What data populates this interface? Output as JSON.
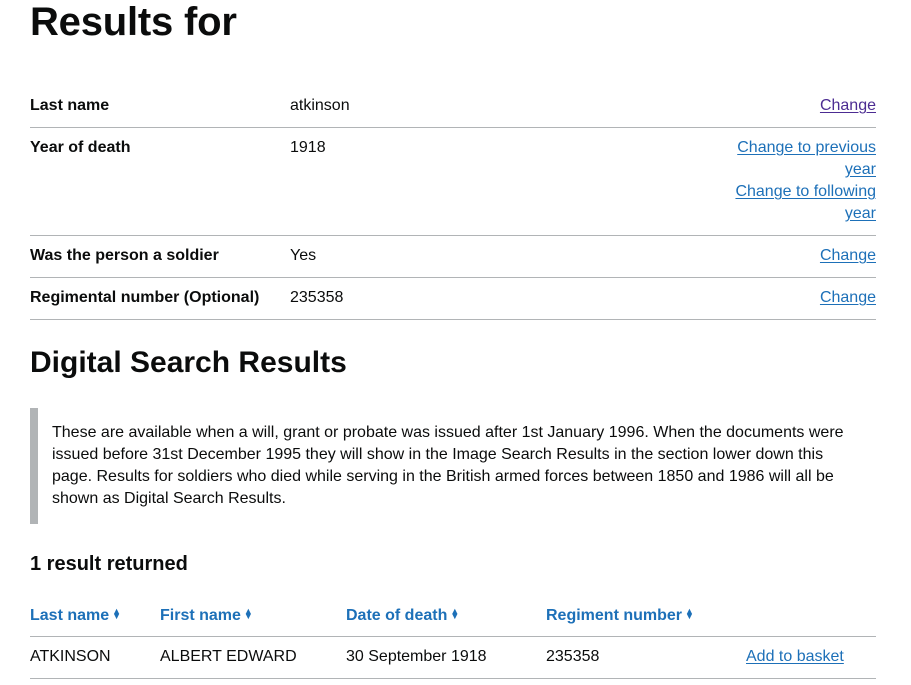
{
  "header": {
    "title": "Results for"
  },
  "summary": [
    {
      "key": "Last name",
      "value": "atkinson",
      "action": "Change"
    },
    {
      "key": "Year of death",
      "value": "1918",
      "action_prev": "Change to previous year",
      "action_next": "Change to following year"
    },
    {
      "key": "Was the person a soldier",
      "value": "Yes",
      "action": "Change"
    },
    {
      "key": "Regimental number (Optional)",
      "value": "235358",
      "action": "Change"
    }
  ],
  "digital": {
    "heading": "Digital Search Results",
    "inset": "These are available when a will, grant or probate was issued after 1st January 1996. When the documents were issued before 31st December 1995 they will show in the Image Search Results in the section lower down this page. Results for soldiers who died while serving in the British armed forces between 1850 and 1986 will all be shown as Digital Search Results.",
    "count": "1 result returned"
  },
  "table": {
    "headers": [
      "Last name",
      "First name",
      "Date of death",
      "Regiment number"
    ],
    "rows": [
      {
        "last": "ATKINSON",
        "first": "ALBERT EDWARD",
        "date": "30 September 1918",
        "regiment": "235358",
        "action": "Add to basket"
      }
    ]
  },
  "icons": {
    "sort": "sort-arrows-icon"
  },
  "colors": {
    "link": "#1d70b8",
    "visited": "#4c2c92",
    "border": "#b1b4b6",
    "text": "#0b0c0c"
  }
}
